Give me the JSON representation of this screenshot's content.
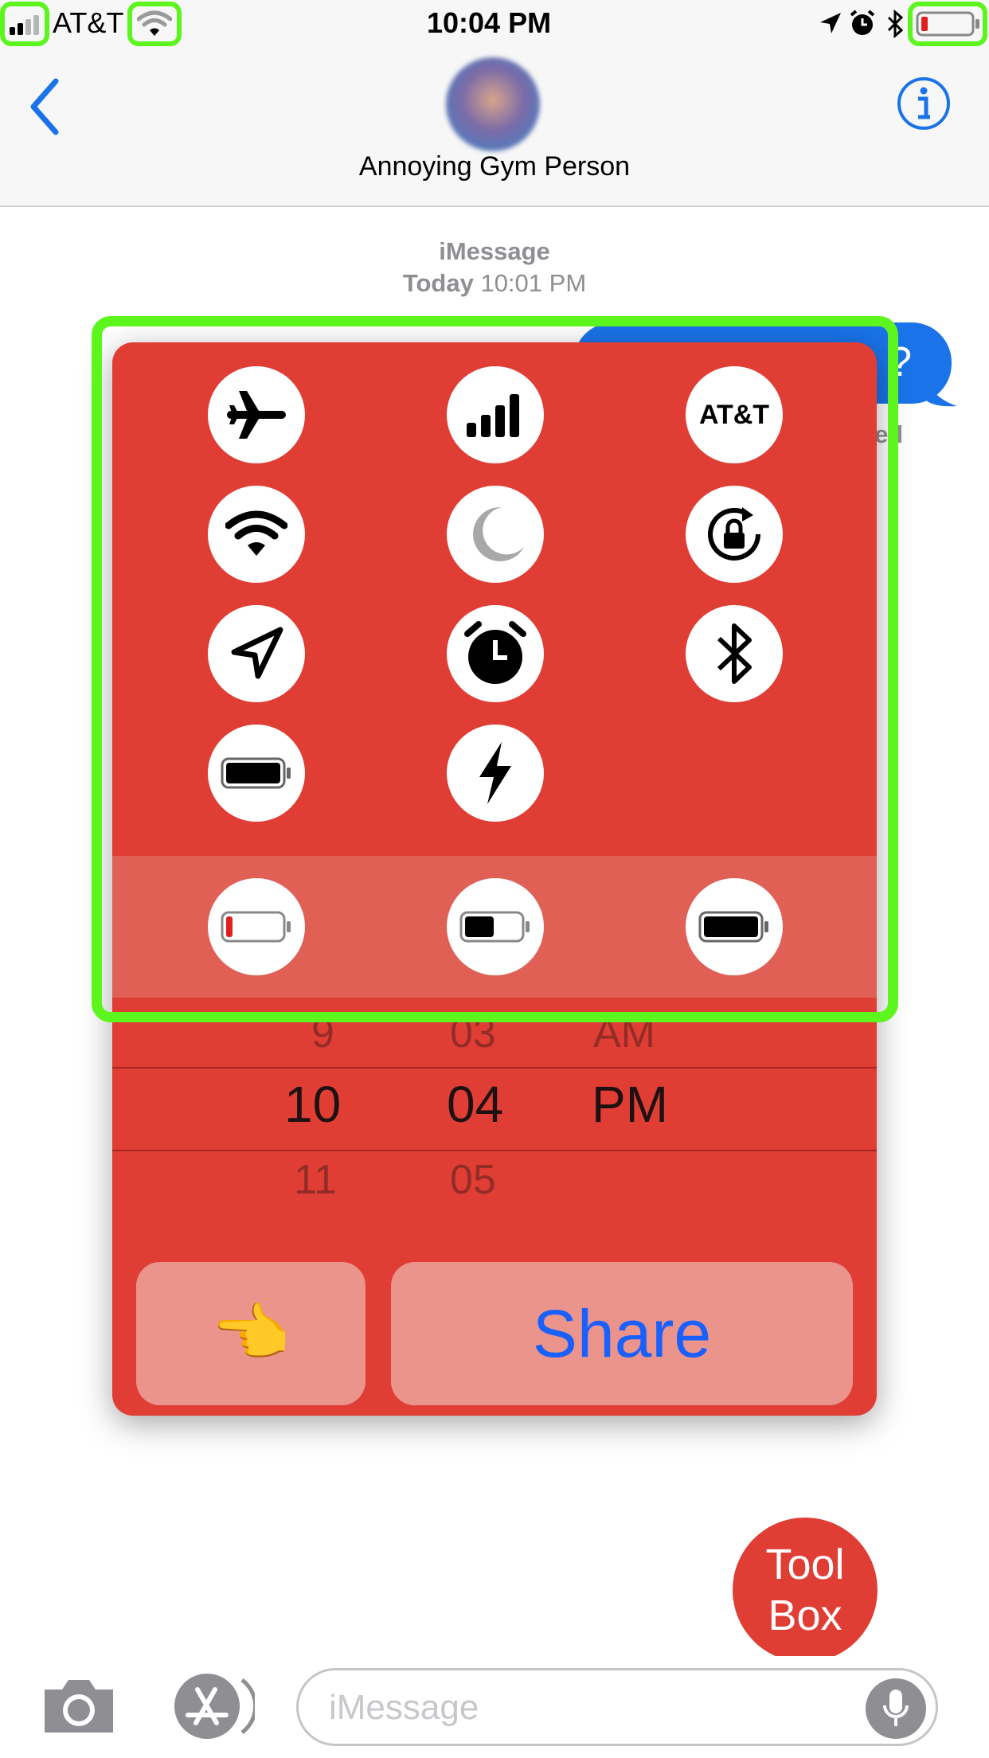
{
  "status_bar": {
    "carrier": "AT&T",
    "time": "10:04 PM"
  },
  "nav": {
    "contact_name": "Annoying Gym Person"
  },
  "conversation": {
    "service_label": "iMessage",
    "date_label": "Today",
    "time_label": "10:01 PM",
    "bubble_text": "?",
    "receipt_text": "red"
  },
  "toolbox": {
    "carrier_badge": "AT&T",
    "picker": {
      "hours": [
        "9",
        "10",
        "11"
      ],
      "minutes": [
        "03",
        "04",
        "05"
      ],
      "periods": [
        "AM",
        "PM"
      ],
      "selected": {
        "hour": "10",
        "minute": "04",
        "period": "PM"
      }
    },
    "emoji_button": "👈",
    "share_button": "Share"
  },
  "fab": {
    "line1": "Tool",
    "line2": "Box"
  },
  "input": {
    "placeholder": "iMessage"
  },
  "colors": {
    "accent": "#1a73e8",
    "panel_red": "#e03d35",
    "highlight_green": "#5cf51d"
  }
}
